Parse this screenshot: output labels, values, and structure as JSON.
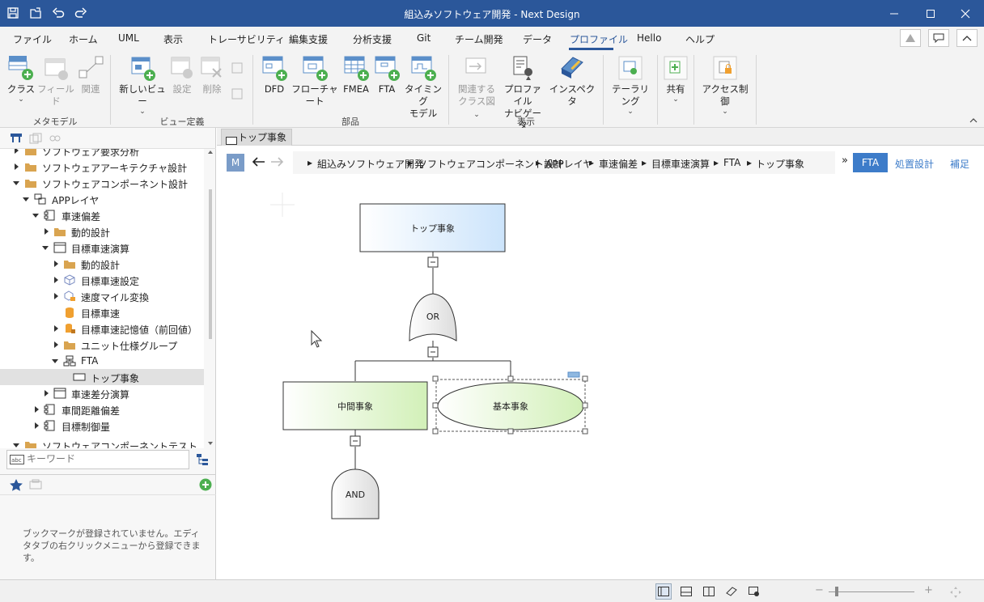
{
  "window": {
    "title": "組込みソフトウェア開発 - Next Design"
  },
  "menu": {
    "items": [
      "ファイル",
      "ホーム",
      "UML",
      "表示",
      "トレーサビリティ",
      "編集支援",
      "分析支援",
      "Git",
      "チーム開発",
      "データ",
      "プロファイル",
      "Hello",
      "ヘルプ"
    ],
    "active": "プロファイル"
  },
  "ribbon": {
    "metamodel": {
      "group": "メタモデル",
      "class": "クラス",
      "field": "フィールド",
      "relation": "関連"
    },
    "viewdef": {
      "group": "ビュー定義",
      "newview": "新しいビュー",
      "settings": "設定",
      "delete": "削除"
    },
    "parts": {
      "group": "部品",
      "dfd": "DFD",
      "flowchart": "フローチャート",
      "fmea": "FMEA",
      "fta": "FTA",
      "timing1": "タイミング",
      "timing2": "モデル"
    },
    "display": {
      "group": "表示",
      "related1": "関連する",
      "related2": "クラス図",
      "navi1": "プロファイル",
      "navi2": "ナビゲータ",
      "inspector": "インスペクタ"
    },
    "tailoring": "テーラリング",
    "share": "共有",
    "access": "アクセス制御"
  },
  "tree": {
    "items": [
      {
        "label": "ソフトウェア要求分析"
      },
      {
        "label": "ソフトウェアアーキテクチャ設計"
      },
      {
        "label": "ソフトウェアコンポーネント設計"
      },
      {
        "label": "APPレイヤ"
      },
      {
        "label": "車速偏差"
      },
      {
        "label": "動的設計"
      },
      {
        "label": "目標車速演算"
      },
      {
        "label": "動的設計"
      },
      {
        "label": "目標車速設定"
      },
      {
        "label": "速度マイル変換"
      },
      {
        "label": "目標車速"
      },
      {
        "label": "目標車速記憶値（前回値）"
      },
      {
        "label": "ユニット仕様グループ"
      },
      {
        "label": "FTA"
      },
      {
        "label": "トップ事象"
      },
      {
        "label": "車速差分演算"
      },
      {
        "label": "車間距離偏差"
      },
      {
        "label": "目標制御量"
      },
      {
        "label": "ソフトウェアコンポーネントテスト"
      }
    ]
  },
  "search": {
    "placeholder": "キーワード"
  },
  "bookmarks": {
    "message": "ブックマークが登録されていません。エディタタブの右クリックメニューから登録できます。"
  },
  "editor": {
    "tab": "トップ事象",
    "mode_badge": "M",
    "breadcrumb": [
      "組込みソフトウェア開発",
      "ソフトウェアコンポーネント設計",
      "APPレイヤ",
      "車速偏差",
      "目標車速演算",
      "FTA",
      "トップ事象"
    ],
    "more": "»",
    "views": {
      "active": "FTA",
      "v2": "処置設計",
      "v3": "補足"
    }
  },
  "diagram": {
    "top": "トップ事象",
    "or_gate": "OR",
    "intermediate": "中間事象",
    "basic": "基本事象",
    "and_gate": "AND",
    "collapse_mark": "−"
  },
  "status": {
    "zoom_minus": "−",
    "zoom_plus": "+"
  }
}
